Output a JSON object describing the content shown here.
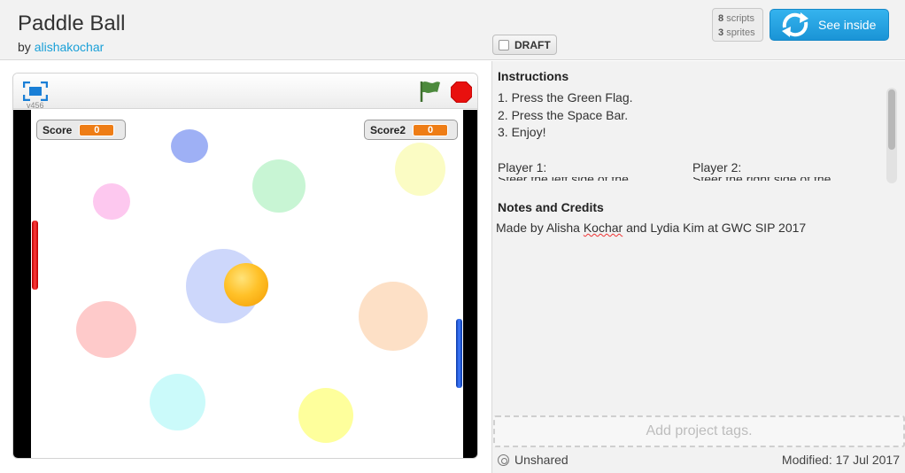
{
  "project": {
    "title": "Paddle Ball",
    "by_prefix": "by",
    "author": "alishakochar",
    "draft_label": "DRAFT",
    "scripts_count": "8",
    "scripts_label": "scripts",
    "sprites_count": "3",
    "sprites_label": "sprites",
    "see_inside_label": "See inside"
  },
  "player": {
    "version": "v456",
    "monitors": [
      {
        "label": "Score",
        "value": "0"
      },
      {
        "label": "Score2",
        "value": "0"
      }
    ]
  },
  "instructions": {
    "heading": "Instructions",
    "lines": [
      "1. Press the Green Flag.",
      "2. Press the Space Bar.",
      "3. Enjoy!"
    ],
    "player1_heading": "Player 1:",
    "player2_heading": "Player 2:",
    "player1_cut": "Steer the left side of the",
    "player2_cut": "Steer the right side of the"
  },
  "notes": {
    "heading": "Notes and Credits",
    "text_before": "Made by Alisha ",
    "text_typo": "Kochar",
    "text_after": " and Lydia Kim at GWC SIP 2017"
  },
  "footer": {
    "tags_placeholder": "Add project tags.",
    "share_status": "Unshared",
    "modified": "Modified: 17 Jul 2017"
  },
  "colors": {
    "accent_blue": "#1a94d6",
    "link": "#1aa0d8",
    "monitor_value": "#ee7d16",
    "stop": "#e8100e",
    "flag": "#4c8a3c"
  }
}
